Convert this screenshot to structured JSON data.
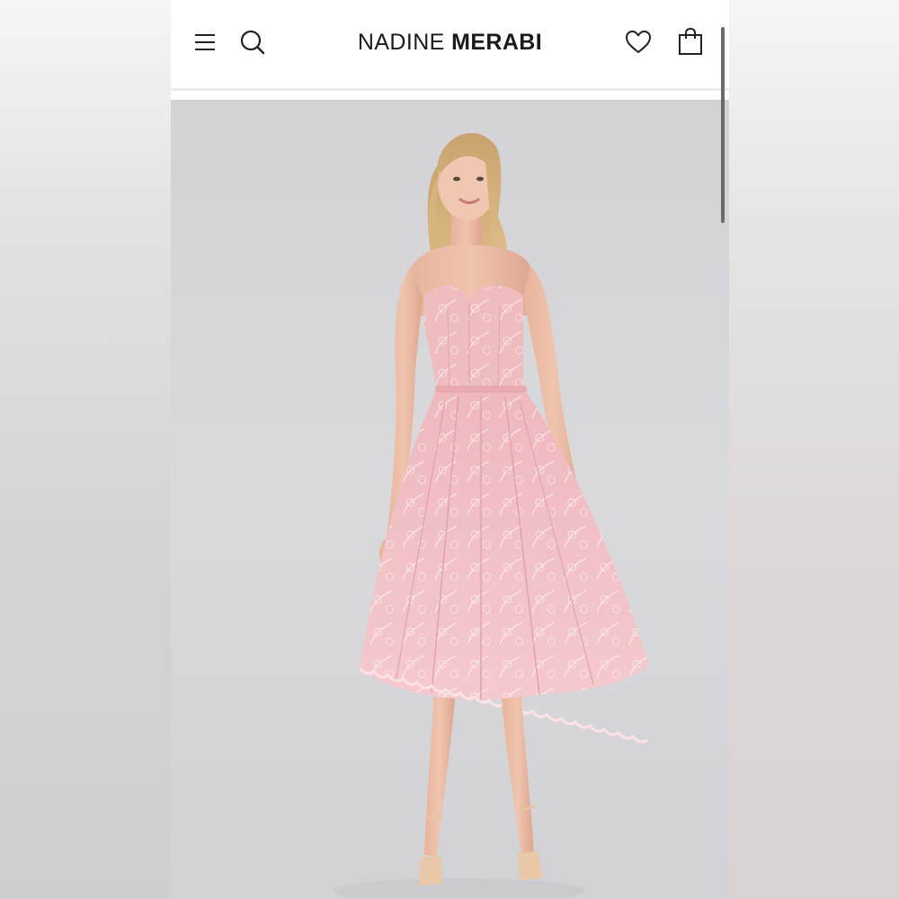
{
  "brand": {
    "name_light": "NADINE",
    "name_bold": "MERABI"
  },
  "header": {
    "icons": {
      "menu": "hamburger-menu-icon",
      "search": "search-icon",
      "wishlist": "heart-icon",
      "cart": "shopping-bag-icon"
    }
  },
  "product_image": {
    "subject": "model-in-pink-strapless-lace-midi-dress"
  },
  "colors": {
    "background": "#ffffff",
    "text": "#1b1b1b",
    "divider": "#ececec",
    "photo_backdrop": "#d6d6da",
    "dress_pink": "#f0bcc0"
  }
}
